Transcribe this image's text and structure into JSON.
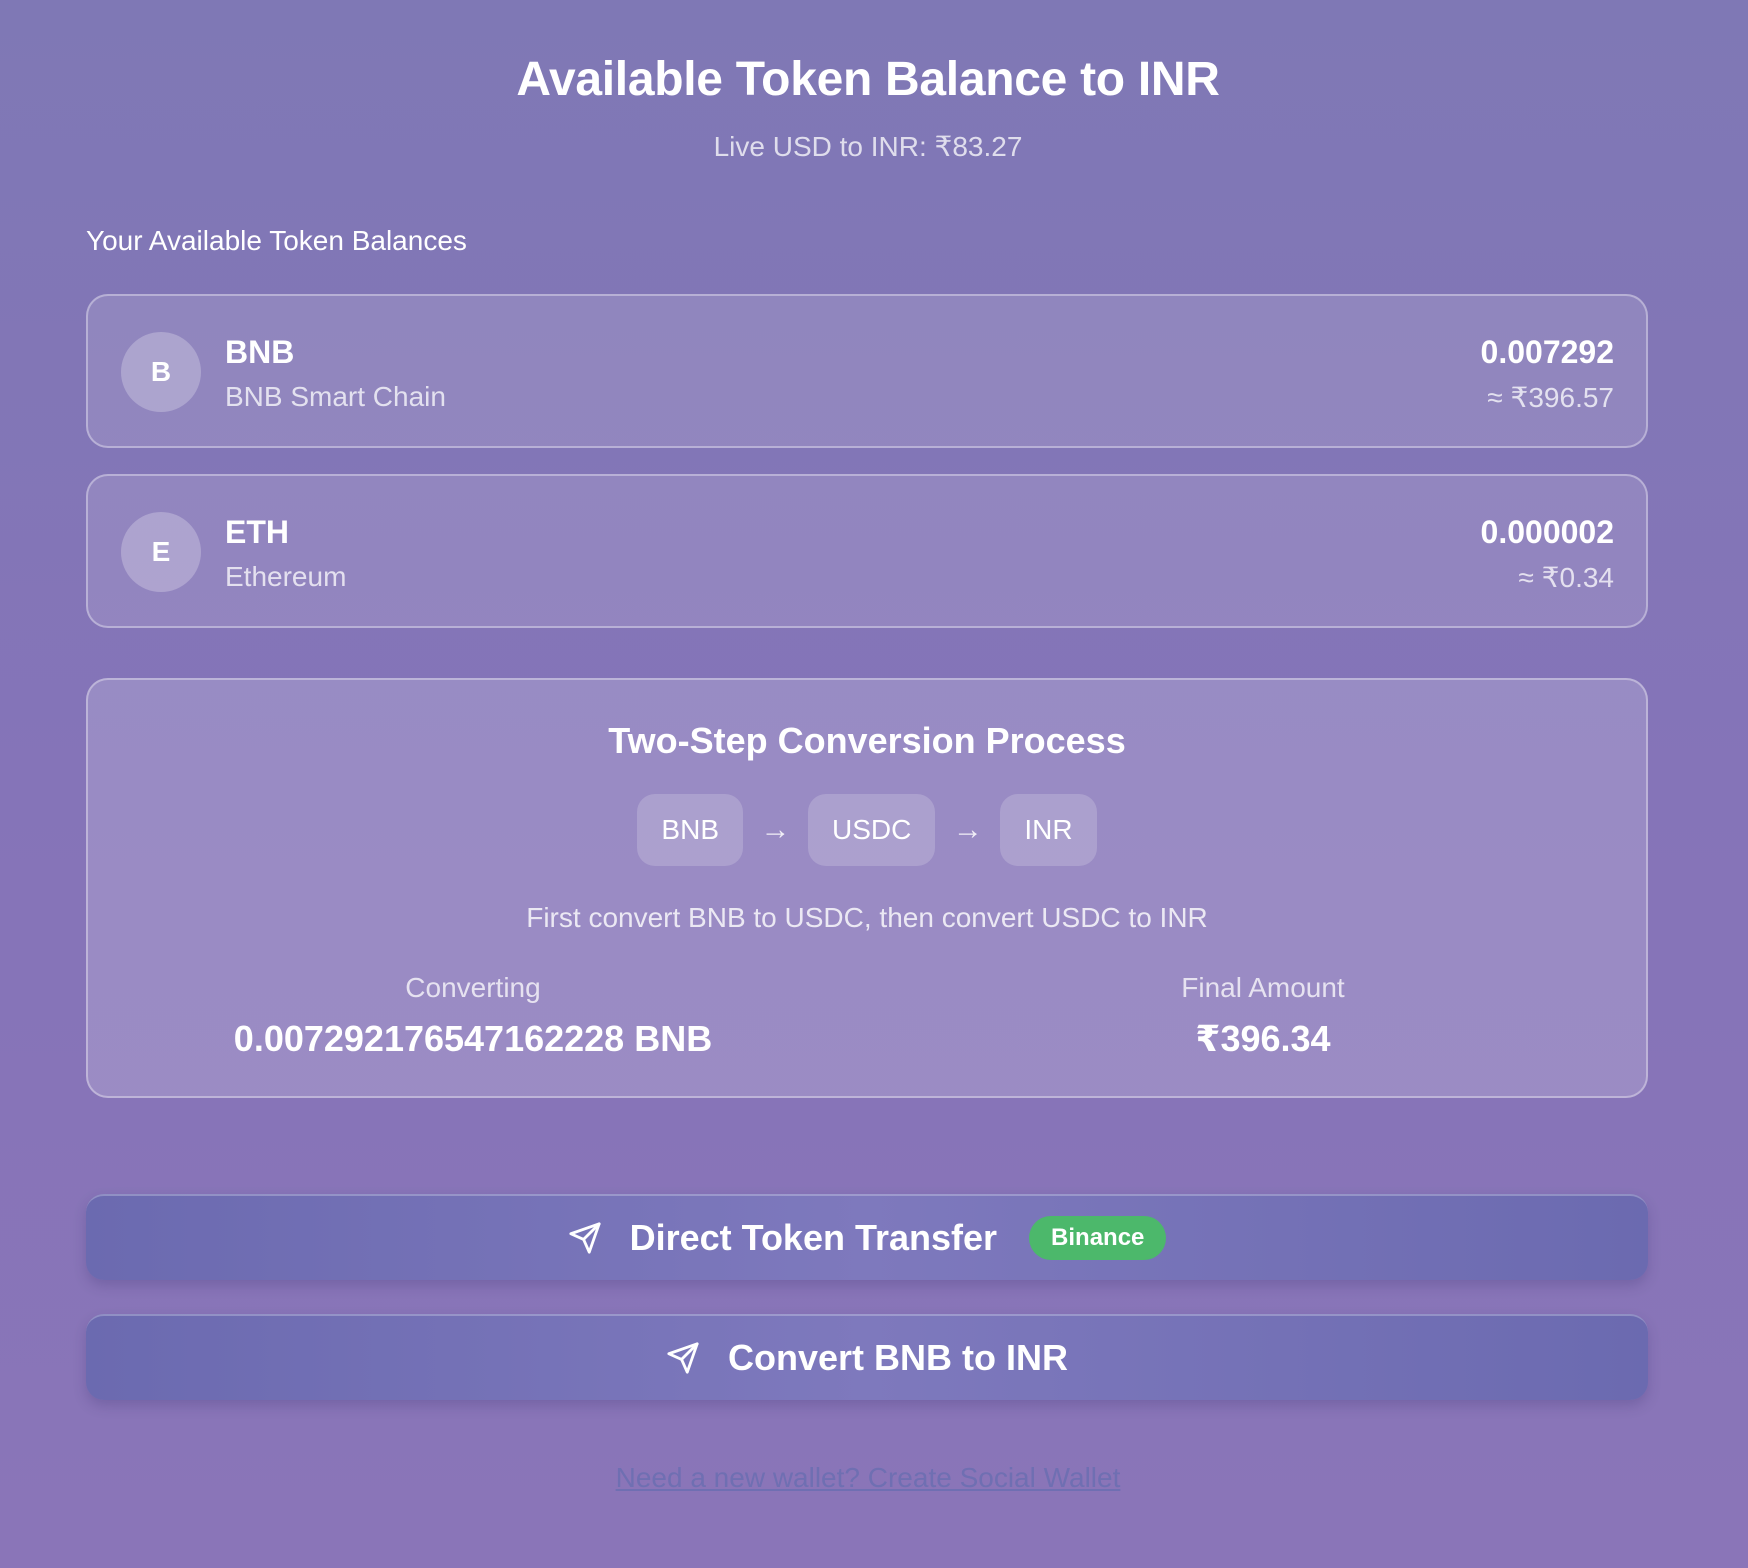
{
  "header": {
    "title": "Available Token Balance to INR",
    "rate": "Live USD to INR: ₹83.27"
  },
  "balances": {
    "label": "Your Available Token Balances",
    "tokens": [
      {
        "initial": "B",
        "symbol": "BNB",
        "network": "BNB Smart Chain",
        "amount": "0.007292",
        "inr": "≈ ₹396.57"
      },
      {
        "initial": "E",
        "symbol": "ETH",
        "network": "Ethereum",
        "amount": "0.000002",
        "inr": "≈ ₹0.34"
      }
    ]
  },
  "process": {
    "title": "Two-Step Conversion Process",
    "steps": [
      "BNB",
      "USDC",
      "INR"
    ],
    "arrow": "→",
    "description": "First convert BNB to USDC, then convert USDC to INR",
    "converting_label": "Converting",
    "converting_value": "0.007292176547162228 BNB",
    "final_label": "Final Amount",
    "final_value": "₹396.34"
  },
  "actions": {
    "direct_label": "Direct Token Transfer",
    "direct_badge": "Binance",
    "convert_label": "Convert BNB to INR",
    "icon": "send-icon"
  },
  "footer": {
    "link": "Need a new wallet? Create Social Wallet"
  },
  "colors": {
    "background": "#8276b8",
    "badge": "#4cb86b",
    "link": "#6f6fb2",
    "button": "#7470b6"
  }
}
